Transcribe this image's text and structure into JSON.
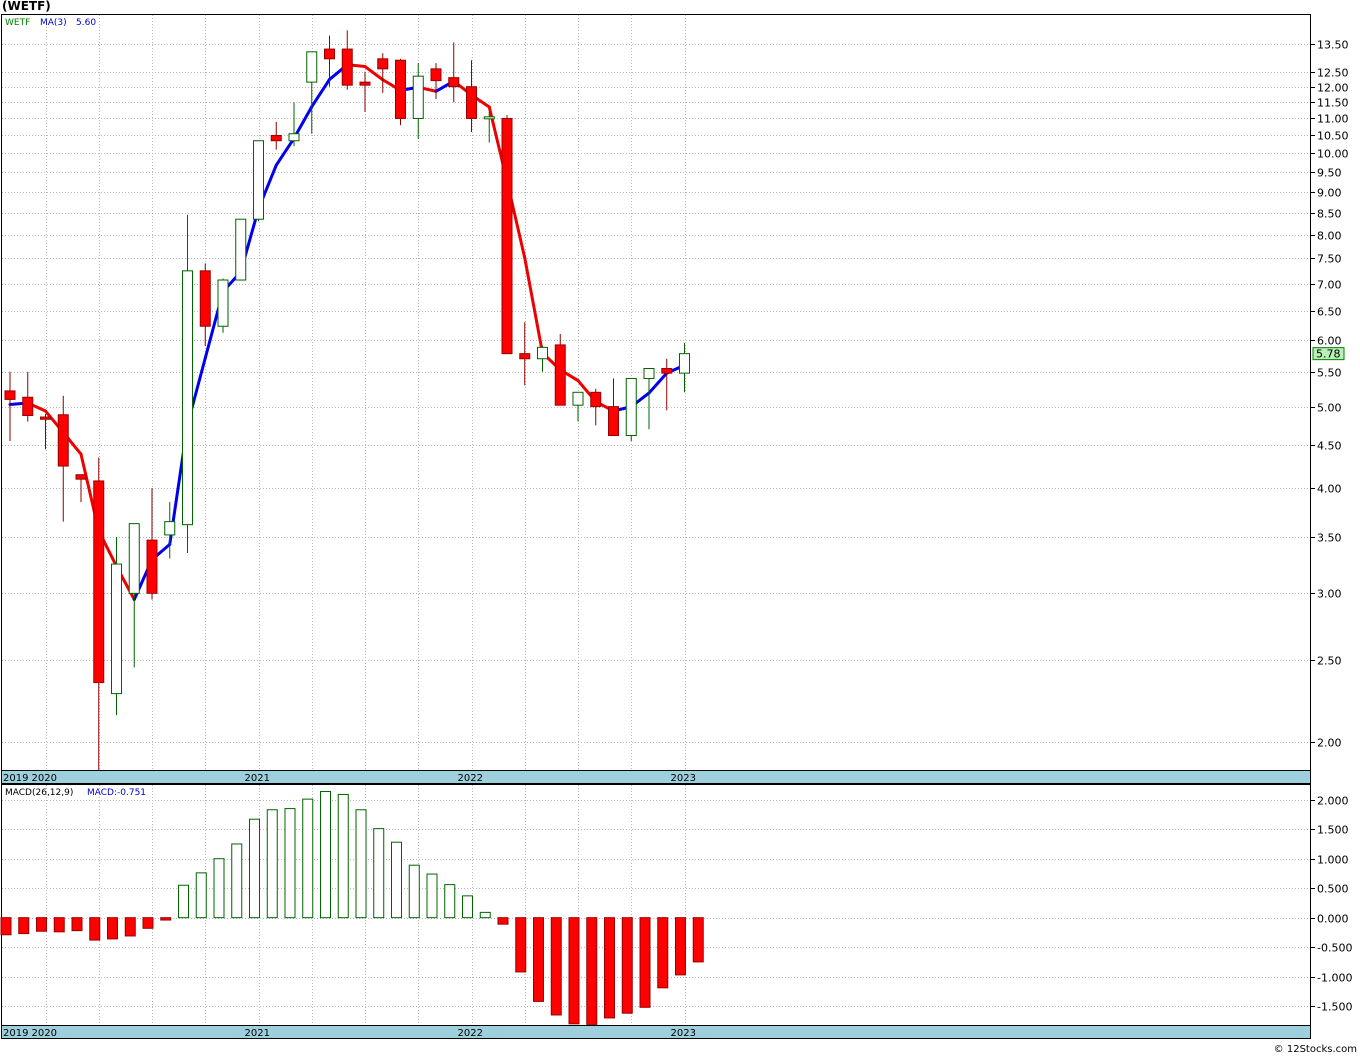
{
  "header": {
    "title": "(WETF)",
    "credit": "© 12Stocks.com"
  },
  "price_panel": {
    "legend": {
      "symbol": "WETF",
      "ma_label": "MA(3)",
      "ma_value": "5.60"
    },
    "last_price_label": "5.78",
    "y_ticks": [
      2.0,
      2.5,
      3.0,
      3.5,
      4.0,
      4.5,
      5.0,
      5.5,
      6.0,
      6.5,
      7.0,
      7.5,
      8.0,
      8.5,
      9.0,
      9.5,
      10.0,
      10.5,
      11.0,
      11.5,
      12.0,
      12.5,
      13.5
    ],
    "y_tick_labels": [
      "2.00",
      "2.50",
      "3.00",
      "3.50",
      "4.00",
      "4.50",
      "5.00",
      "5.50",
      "6.00",
      "6.50",
      "7.00",
      "7.50",
      "8.00",
      "8.50",
      "9.00",
      "9.50",
      "10.00",
      "10.50",
      "11.00",
      "11.50",
      "12.00",
      "12.50",
      "13.50"
    ],
    "x_labels": [
      "2019",
      "2020",
      "2021",
      "2022",
      "2023"
    ]
  },
  "macd_panel": {
    "legend": {
      "label": "MACD(26,12,9)",
      "value_label": "MACD:-0.751"
    },
    "y_ticks": [
      2.0,
      1.5,
      1.0,
      0.5,
      0.0,
      -0.5,
      -1.0,
      -1.5
    ],
    "y_tick_labels": [
      "2.000",
      "1.500",
      "1.000",
      "0.500",
      "0.000",
      "-0.500",
      "-1.000",
      "-1.500"
    ],
    "x_labels": [
      "2019",
      "2020",
      "2021",
      "2022",
      "2023"
    ]
  },
  "chart_data": [
    {
      "type": "candlestick",
      "title": "(WETF)",
      "scale": "log",
      "ylim": [
        1.85,
        14.6
      ],
      "months": [
        "2019-11",
        "2019-12",
        "2020-01",
        "2020-02",
        "2020-03",
        "2020-04",
        "2020-05",
        "2020-06",
        "2020-07",
        "2020-08",
        "2020-09",
        "2020-10",
        "2020-11",
        "2020-12",
        "2021-01",
        "2021-02",
        "2021-03",
        "2021-04",
        "2021-05",
        "2021-06",
        "2021-07",
        "2021-08",
        "2021-09",
        "2021-10",
        "2021-11",
        "2021-12",
        "2022-01",
        "2022-02",
        "2022-03",
        "2022-04",
        "2022-05",
        "2022-06",
        "2022-07",
        "2022-08",
        "2022-09",
        "2022-10",
        "2022-11",
        "2022-12",
        "2023-01"
      ],
      "open": [
        5.22,
        5.13,
        4.86,
        4.89,
        4.15,
        4.08,
        2.28,
        3.0,
        3.47,
        3.52,
        3.62,
        7.25,
        6.23,
        7.07,
        8.35,
        10.5,
        10.35,
        12.15,
        13.3,
        13.3,
        12.15,
        12.95,
        12.9,
        11.0,
        12.6,
        12.3,
        12.0,
        11.05,
        11.0,
        5.78,
        5.7,
        5.92,
        5.02,
        5.2,
        5.0,
        4.62,
        5.4,
        5.55,
        5.48
      ],
      "high": [
        5.5,
        5.5,
        4.9,
        5.15,
        4.15,
        4.35,
        3.5,
        3.5,
        4.0,
        3.85,
        8.45,
        7.4,
        7.1,
        8.2,
        8.6,
        10.9,
        11.5,
        13.2,
        13.8,
        14.0,
        12.5,
        13.15,
        12.95,
        12.8,
        12.8,
        13.55,
        12.9,
        11.2,
        11.1,
        6.3,
        5.9,
        6.1,
        5.15,
        5.25,
        5.4,
        5.0,
        5.55,
        5.7,
        5.95
      ],
      "low": [
        4.55,
        4.8,
        4.45,
        3.65,
        3.85,
        1.85,
        2.15,
        2.45,
        2.95,
        3.3,
        3.35,
        5.9,
        6.12,
        7.1,
        8.3,
        10.1,
        10.2,
        10.55,
        12.0,
        11.9,
        11.2,
        11.8,
        10.8,
        10.4,
        11.6,
        11.5,
        10.6,
        10.3,
        5.8,
        5.3,
        5.5,
        5.05,
        4.8,
        4.75,
        4.82,
        4.55,
        4.7,
        4.95,
        5.2
      ],
      "close": [
        5.1,
        4.88,
        4.83,
        4.25,
        4.1,
        2.35,
        3.25,
        3.63,
        3.0,
        3.65,
        7.25,
        6.23,
        7.07,
        8.35,
        10.35,
        10.35,
        10.55,
        13.2,
        12.95,
        12.05,
        12.05,
        12.6,
        11.0,
        12.35,
        12.2,
        12.0,
        11.0,
        11.05,
        5.78,
        5.7,
        5.88,
        5.02,
        5.2,
        5.0,
        4.62,
        5.4,
        5.55,
        5.48,
        5.78
      ],
      "series": [
        {
          "name": "MA(3)",
          "values": [
            5.03,
            5.05,
            4.94,
            4.66,
            4.39,
            3.56,
            3.23,
            2.95,
            3.29,
            3.43,
            4.76,
            5.71,
            6.85,
            7.23,
            8.59,
            9.68,
            10.42,
            11.36,
            12.24,
            12.74,
            12.68,
            12.23,
            11.88,
            11.98,
            11.85,
            12.18,
            11.73,
            11.35,
            9.27,
            7.51,
            5.79,
            5.53,
            5.37,
            5.07,
            4.94,
            5.0,
            5.19,
            5.48,
            5.6
          ]
        }
      ],
      "x_labels": [
        "2019",
        "2020",
        "2021",
        "2022",
        "2023"
      ]
    },
    {
      "type": "bar",
      "title": "MACD(26,12,9)",
      "ylim": [
        -1.82,
        2.25
      ],
      "months": [
        "2019-11",
        "2019-12",
        "2020-01",
        "2020-02",
        "2020-03",
        "2020-04",
        "2020-05",
        "2020-06",
        "2020-07",
        "2020-08",
        "2020-09",
        "2020-10",
        "2020-11",
        "2020-12",
        "2021-01",
        "2021-02",
        "2021-03",
        "2021-04",
        "2021-05",
        "2021-06",
        "2021-07",
        "2021-08",
        "2021-09",
        "2021-10",
        "2021-11",
        "2021-12",
        "2022-01",
        "2022-02",
        "2022-03",
        "2022-04",
        "2022-05",
        "2022-06",
        "2022-07",
        "2022-08",
        "2022-09",
        "2022-10",
        "2022-11",
        "2022-12",
        "2023-01"
      ],
      "series": [
        {
          "name": "MACD",
          "values": [
            -0.29,
            -0.27,
            -0.23,
            -0.24,
            -0.22,
            -0.38,
            -0.36,
            -0.31,
            -0.18,
            -0.04,
            0.55,
            0.76,
            1.0,
            1.25,
            1.67,
            1.83,
            1.85,
            2.01,
            2.14,
            2.09,
            1.83,
            1.51,
            1.28,
            0.89,
            0.74,
            0.56,
            0.37,
            0.09,
            -0.11,
            -0.92,
            -1.42,
            -1.65,
            -1.8,
            -1.81,
            -1.7,
            -1.62,
            -1.52,
            -1.19,
            -0.97,
            -0.75
          ]
        }
      ],
      "x_labels": [
        "2019",
        "2020",
        "2021",
        "2022",
        "2023"
      ]
    }
  ]
}
